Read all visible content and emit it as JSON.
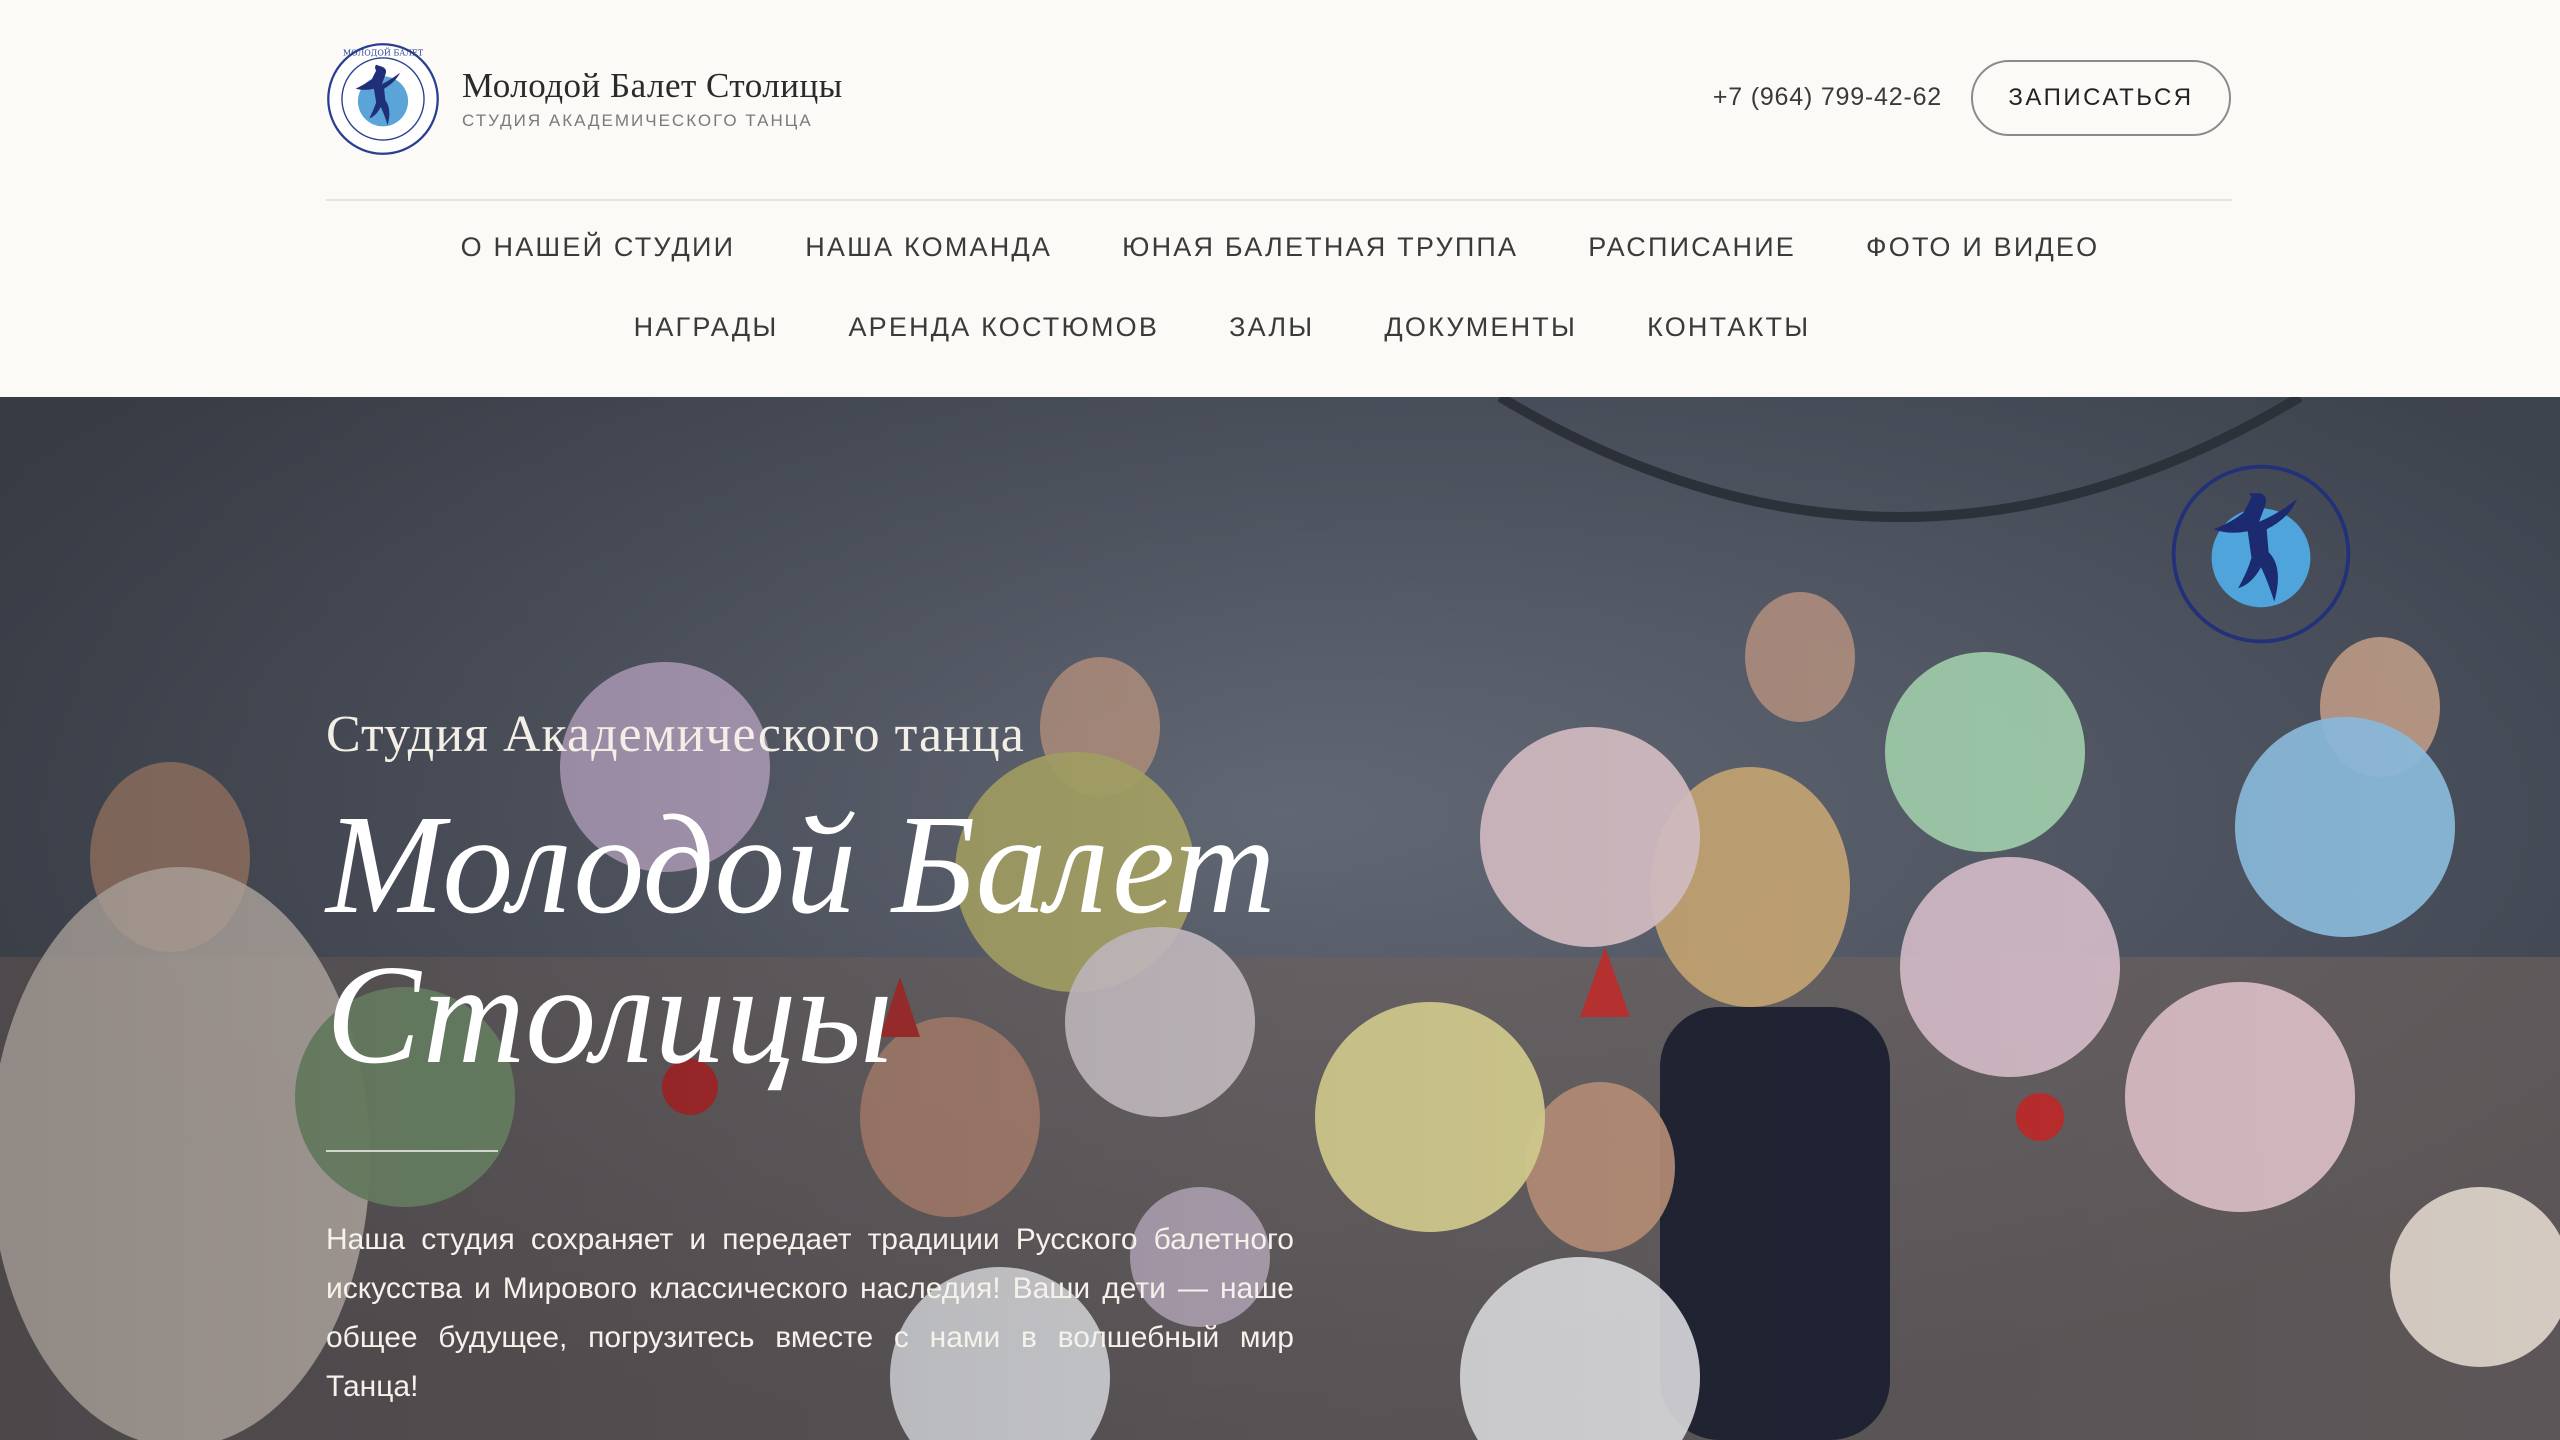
{
  "header": {
    "brand_name": "Молодой Балет Столицы",
    "brand_subtitle": "СТУДИЯ АКАДЕМИЧЕСКОГО ТАНЦА",
    "logo_icon": "ballerina-logo-icon",
    "phone": "+7 (964) 799-42-62",
    "signup_label": "ЗАПИСАТЬСЯ"
  },
  "nav": {
    "row1": [
      "О НАШЕЙ СТУДИИ",
      "НАША КОМАНДА",
      "ЮНАЯ БАЛЕТНАЯ ТРУППА",
      "РАСПИСАНИЕ",
      "ФОТО И ВИДЕО"
    ],
    "row2": [
      "НАГРАДЫ",
      "АРЕНДА КОСТЮМОВ",
      "ЗАЛЫ",
      "ДОКУМЕНТЫ",
      "КОНТАКТЫ"
    ]
  },
  "hero": {
    "subtitle": "Студия Академического танца",
    "title_line1": "Молодой Балет",
    "title_line2": "Столицы",
    "description": "Наша студия сохраняет и передает традиции Русского балетного искусства и Мирового классического наследия! Ваши дети — наше общее будущее, погрузитесь вместе с нами в волшебный мир Танца!",
    "emblem_icon": "ballerina-emblem-icon"
  },
  "colors": {
    "page_bg": "#fbfaf6",
    "text_dark": "#2b2b2b",
    "hero_text": "#ffffff",
    "logo_blue": "#2a3f8f"
  }
}
